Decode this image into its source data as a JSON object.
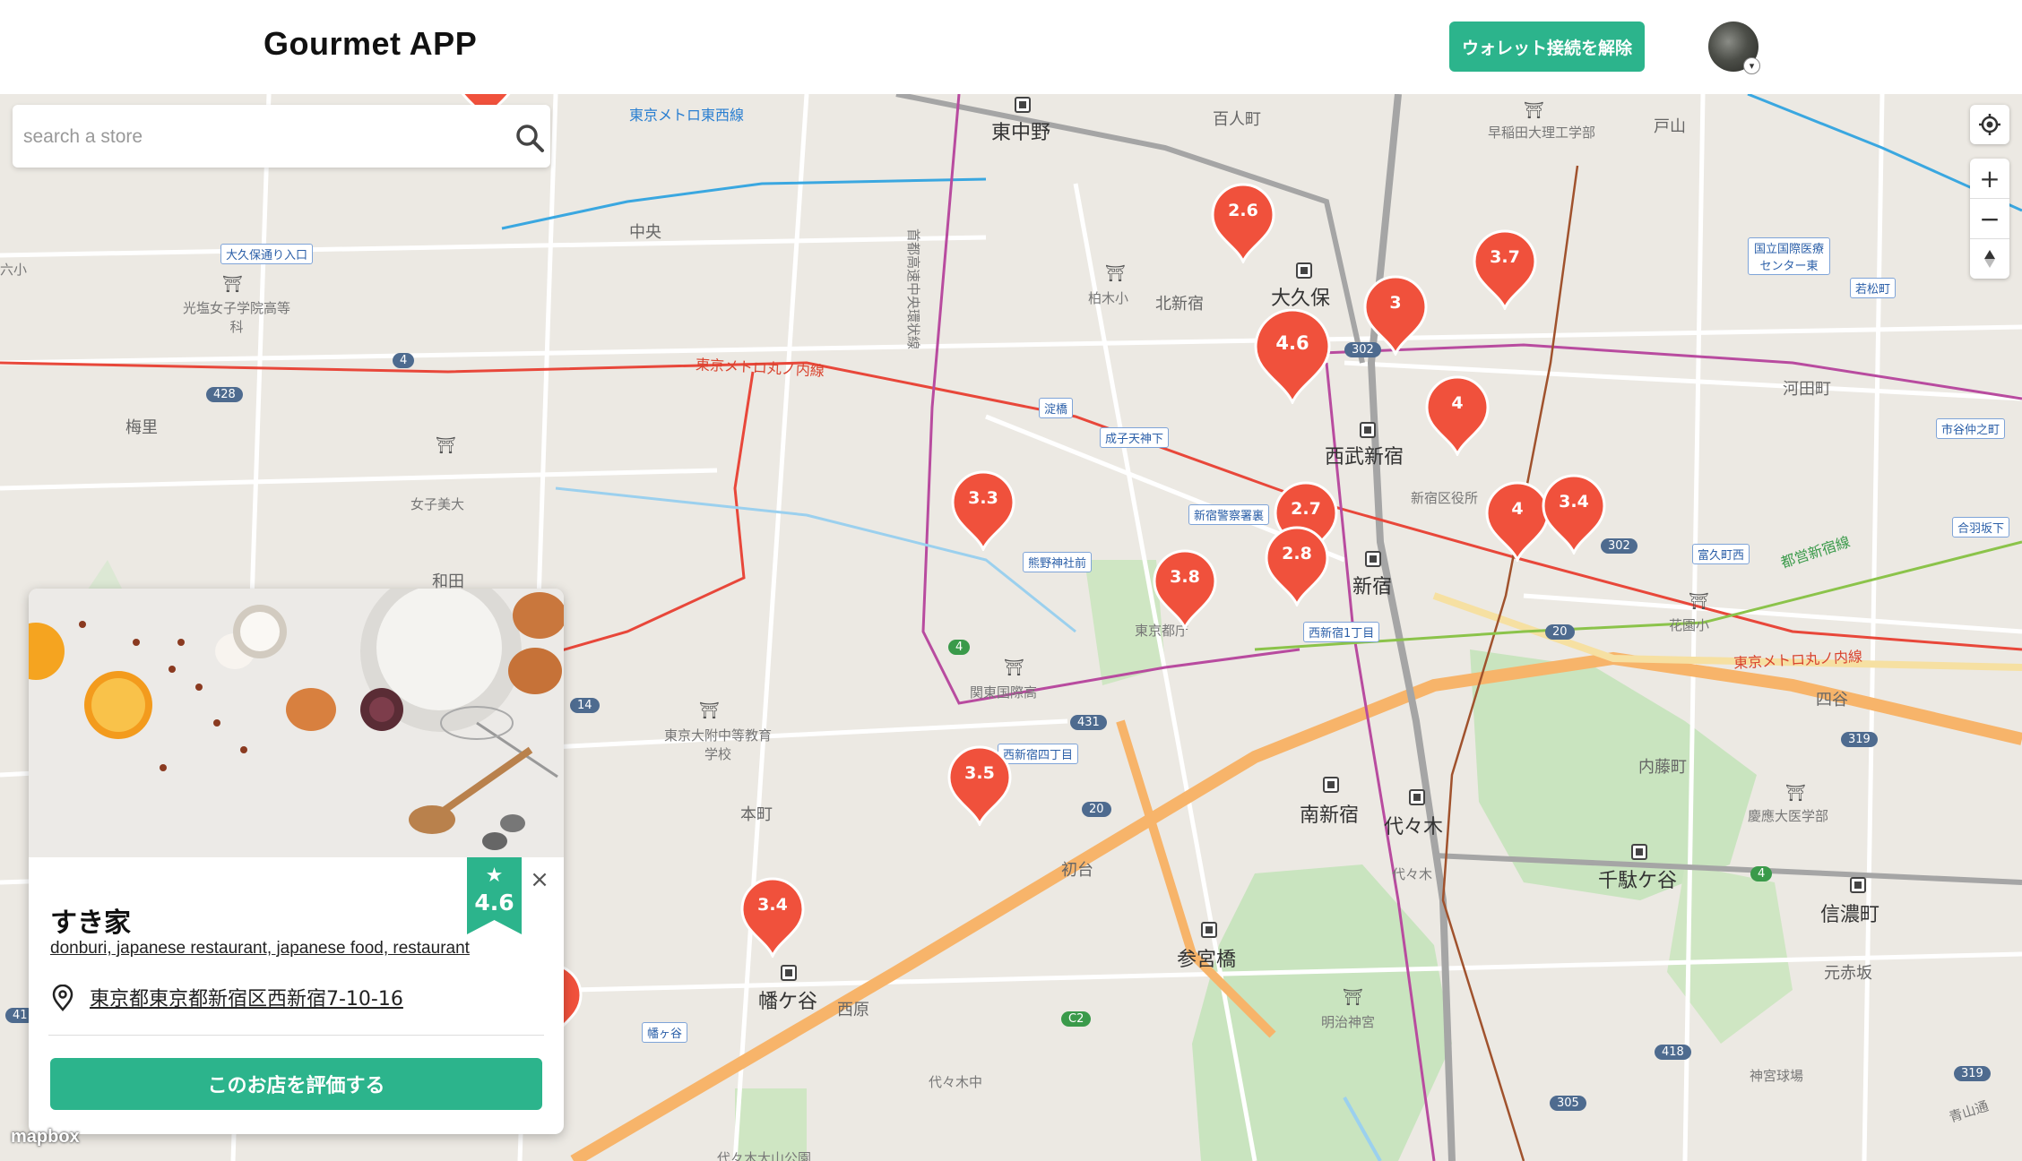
{
  "header": {
    "logo": "Gourmet APP",
    "wallet_button": "ウォレット接続を解除"
  },
  "search": {
    "placeholder": "search a store"
  },
  "map": {
    "places_big": [
      "東中野",
      "大久保",
      "西武新宿",
      "新宿",
      "南新宿",
      "代々木",
      "千駄ケ谷",
      "信濃町",
      "参宮橋",
      "幡ケ谷"
    ],
    "places_mid": [
      "百人町",
      "中央",
      "北新宿",
      "梅里",
      "和田",
      "本町",
      "初台",
      "西原",
      "河田町",
      "四谷",
      "内藤町",
      "元赤坂",
      "戸山",
      "六小",
      "代々木中",
      "代々木"
    ],
    "schools": [
      "早稲田大理工学部",
      "光塩女子学院高等科",
      "柏木小",
      "女子美大",
      "東京大附中等教育学校",
      "関東国際高",
      "花園小",
      "慶應大医学部",
      "新宿区役所",
      "東京都庁",
      "明治神宮",
      "神宮球場",
      "代々木大山公園"
    ],
    "lines": [
      "東京メトロ東西線",
      "東京メトロ丸ノ内線",
      "東京メトロ丸ノ内線",
      "都営新宿線",
      "首都高速中央環状線",
      "青山通"
    ],
    "signs": [
      "大久保通り入口",
      "淀橋",
      "成子天神下",
      "新宿警察署裏",
      "熊野神社前",
      "西新宿1丁目",
      "西新宿四丁目",
      "幡ヶ谷",
      "国立国際医療センター東",
      "若松町",
      "市谷仲之町",
      "合羽坂下",
      "富久町西"
    ],
    "shields": [
      "4",
      "428",
      "302",
      "302",
      "14",
      "4",
      "431",
      "20",
      "20",
      "319",
      "4",
      "418",
      "305",
      "319",
      "C2",
      "41"
    ],
    "markers": [
      "2.6",
      "3.7",
      "3",
      "4.6",
      "4",
      "3.3",
      "2.7",
      "2.8",
      "4",
      "3.4",
      "3.8",
      "3.5",
      "3.4"
    ],
    "attribution": "mapbox"
  },
  "controls": {
    "zoom_in": "+",
    "zoom_out": "−"
  },
  "popup": {
    "rating": "4.6",
    "name": "すき家",
    "tags": "donburi, japanese restaurant, japanese food, restaurant",
    "address": "東京都東京都新宿区西新宿7-10-16",
    "rate_button": "このお店を評価する"
  },
  "colors": {
    "accent": "#2cb48c",
    "marker": "#f0513c"
  }
}
